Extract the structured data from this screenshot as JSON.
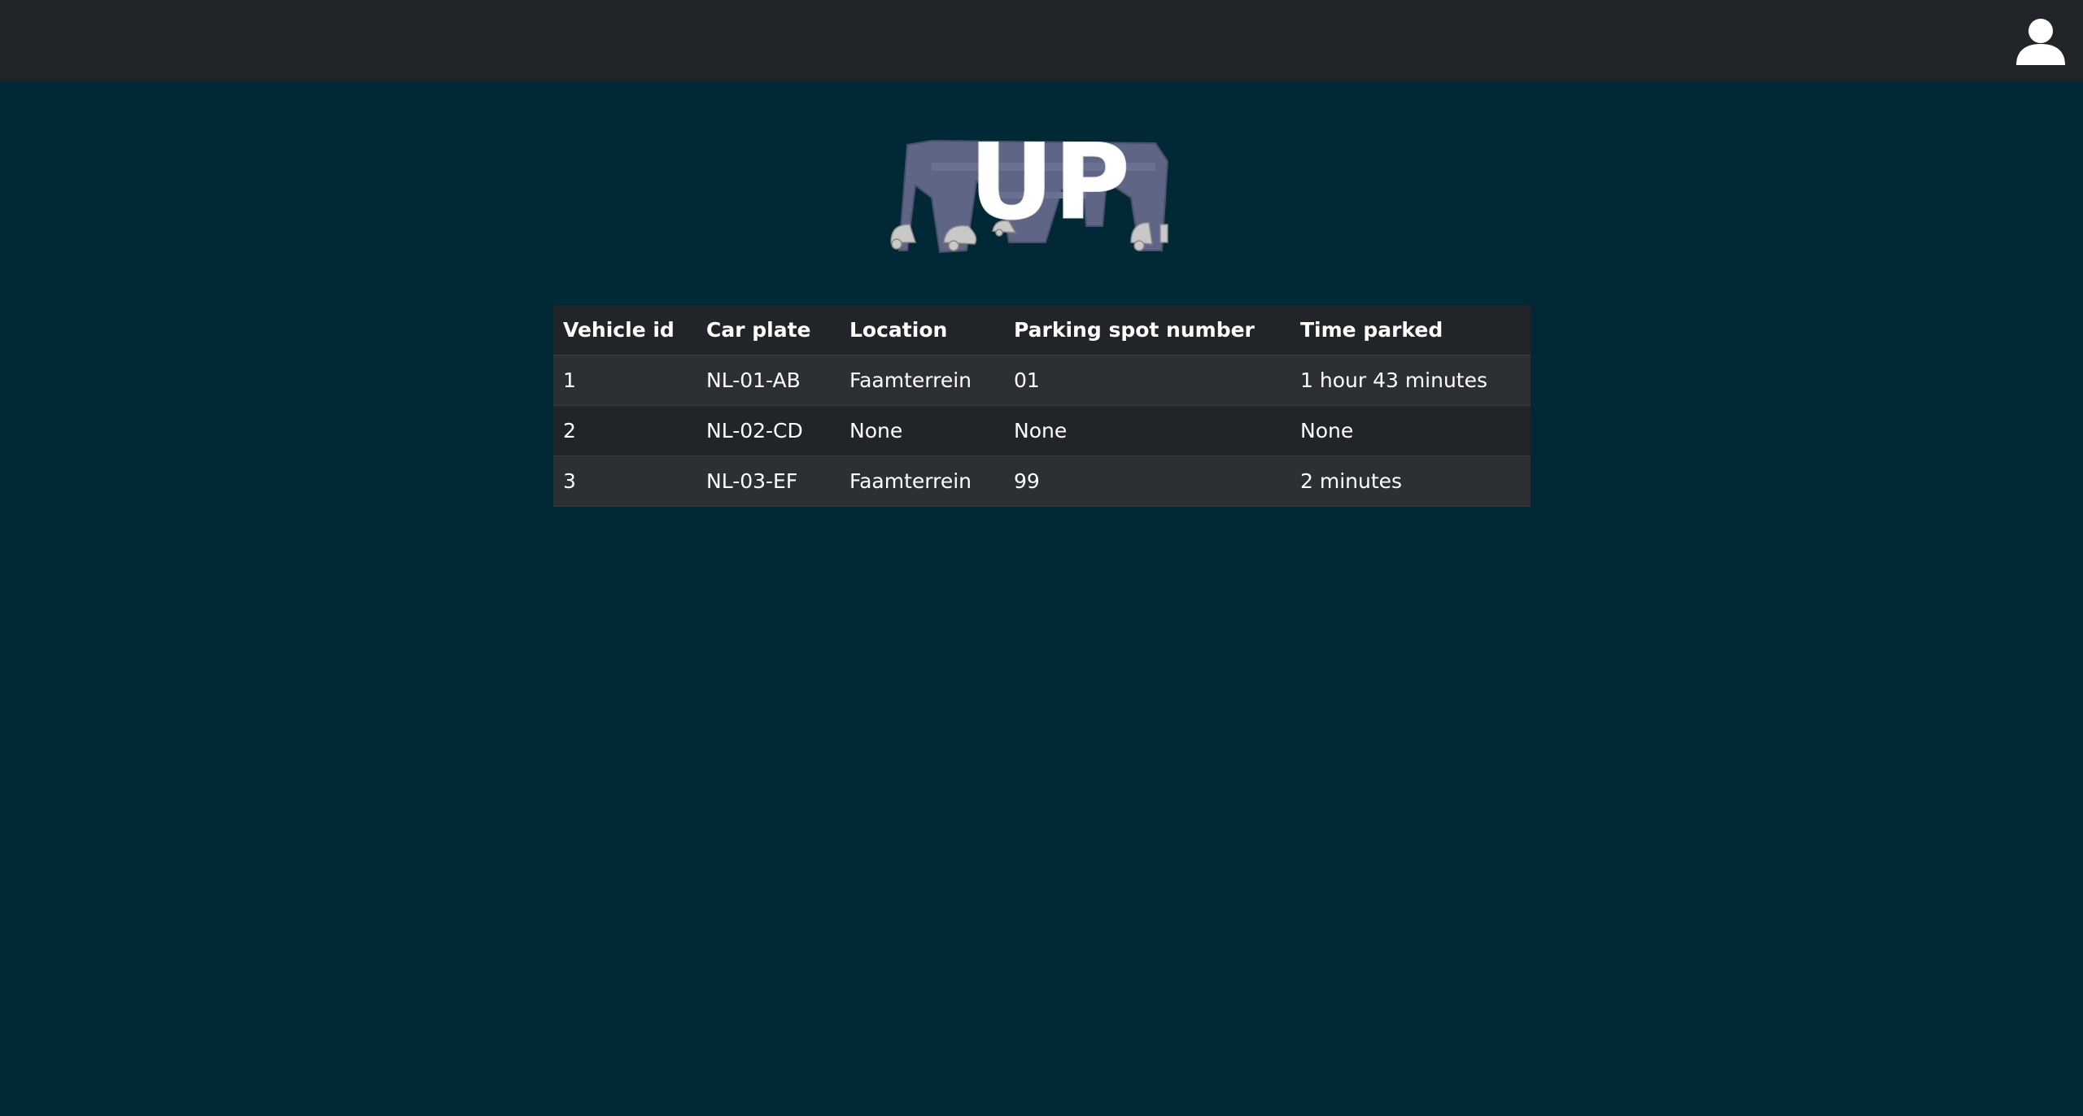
{
  "header": {
    "user_icon": "user-icon"
  },
  "logo": {
    "text": "UP"
  },
  "table": {
    "columns": [
      "Vehicle id",
      "Car plate",
      "Location",
      "Parking spot number",
      "Time parked"
    ],
    "rows": [
      [
        "1",
        "NL-01-AB",
        "Faamterrein",
        "01",
        "1 hour 43 minutes"
      ],
      [
        "2",
        "NL-02-CD",
        "None",
        "None",
        "None"
      ],
      [
        "3",
        "NL-03-EF",
        "Faamterrein",
        "99",
        "2 minutes"
      ]
    ]
  },
  "colors": {
    "page_background": "#012835",
    "navbar": "#212529",
    "table_row_odd": "#2c3034",
    "table_row_even": "#212529",
    "logo_structure": "#5f6585",
    "logo_cars": "#c8c8c8",
    "text": "#ffffff"
  }
}
